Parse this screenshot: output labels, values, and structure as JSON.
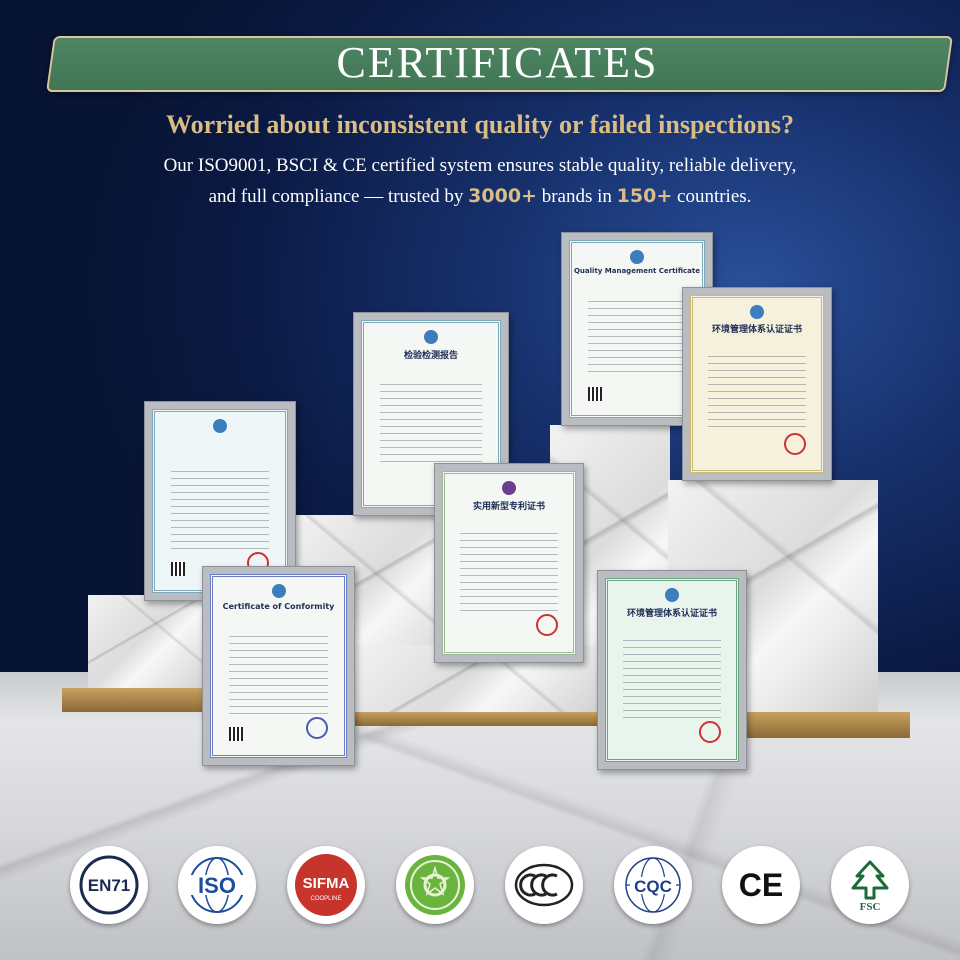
{
  "header": {
    "title": "CERTIFICATES",
    "headline": "Worried about inconsistent quality or failed inspections?",
    "sub_line1": "Our ISO9001, BSCI & CE certified system ensures stable quality, reliable delivery,",
    "sub_line2_a": "and full compliance — trusted by ",
    "sub_line2_brands": "3000+",
    "sub_line2_b": " brands in ",
    "sub_line2_countries": "150+",
    "sub_line2_c": " countries."
  },
  "certificates": [
    {
      "title": "检验检测报告"
    },
    {
      "title": "Quality Management Certificate"
    },
    {
      "title": "环境管理体系认证证书"
    },
    {
      "title": "Certificate of Conformity"
    },
    {
      "title": "实用新型专利证书"
    },
    {
      "title": "环境管理体系认证证书"
    },
    {
      "title": ""
    }
  ],
  "logos": [
    {
      "name": "en71-logo",
      "label": "EN71"
    },
    {
      "name": "iso-logo",
      "label": "ISO"
    },
    {
      "name": "sifma-logo",
      "label": "SIFMA",
      "sublabel": "COOPLINE"
    },
    {
      "name": "green-mark-logo",
      "label": ""
    },
    {
      "name": "ccc-logo",
      "label": "CCC"
    },
    {
      "name": "cqc-logo",
      "label": "CQC"
    },
    {
      "name": "ce-logo",
      "label": "CE"
    },
    {
      "name": "fsc-logo",
      "label": "FSC"
    }
  ],
  "colors": {
    "banner": "#4a7f5d",
    "accent": "#d9bd86",
    "background": "#0d1f4a"
  }
}
